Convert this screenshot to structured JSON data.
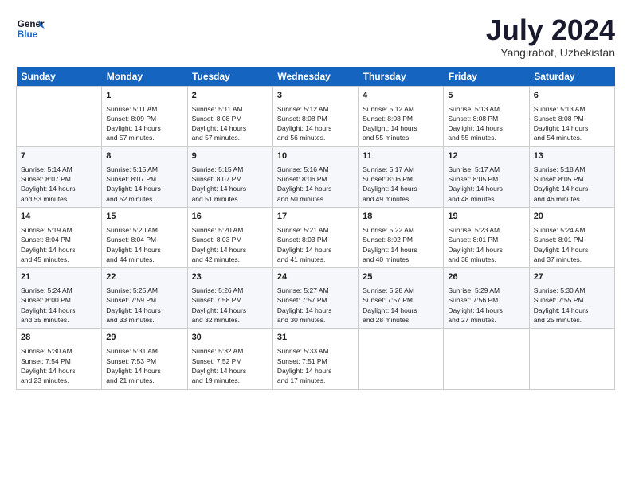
{
  "logo": {
    "line1": "General",
    "line2": "Blue"
  },
  "title": "July 2024",
  "subtitle": "Yangirabot, Uzbekistan",
  "days_header": [
    "Sunday",
    "Monday",
    "Tuesday",
    "Wednesday",
    "Thursday",
    "Friday",
    "Saturday"
  ],
  "weeks": [
    [
      {
        "num": "",
        "data": ""
      },
      {
        "num": "1",
        "data": "Sunrise: 5:11 AM\nSunset: 8:09 PM\nDaylight: 14 hours\nand 57 minutes."
      },
      {
        "num": "2",
        "data": "Sunrise: 5:11 AM\nSunset: 8:08 PM\nDaylight: 14 hours\nand 57 minutes."
      },
      {
        "num": "3",
        "data": "Sunrise: 5:12 AM\nSunset: 8:08 PM\nDaylight: 14 hours\nand 56 minutes."
      },
      {
        "num": "4",
        "data": "Sunrise: 5:12 AM\nSunset: 8:08 PM\nDaylight: 14 hours\nand 55 minutes."
      },
      {
        "num": "5",
        "data": "Sunrise: 5:13 AM\nSunset: 8:08 PM\nDaylight: 14 hours\nand 55 minutes."
      },
      {
        "num": "6",
        "data": "Sunrise: 5:13 AM\nSunset: 8:08 PM\nDaylight: 14 hours\nand 54 minutes."
      }
    ],
    [
      {
        "num": "7",
        "data": "Sunrise: 5:14 AM\nSunset: 8:07 PM\nDaylight: 14 hours\nand 53 minutes."
      },
      {
        "num": "8",
        "data": "Sunrise: 5:15 AM\nSunset: 8:07 PM\nDaylight: 14 hours\nand 52 minutes."
      },
      {
        "num": "9",
        "data": "Sunrise: 5:15 AM\nSunset: 8:07 PM\nDaylight: 14 hours\nand 51 minutes."
      },
      {
        "num": "10",
        "data": "Sunrise: 5:16 AM\nSunset: 8:06 PM\nDaylight: 14 hours\nand 50 minutes."
      },
      {
        "num": "11",
        "data": "Sunrise: 5:17 AM\nSunset: 8:06 PM\nDaylight: 14 hours\nand 49 minutes."
      },
      {
        "num": "12",
        "data": "Sunrise: 5:17 AM\nSunset: 8:05 PM\nDaylight: 14 hours\nand 48 minutes."
      },
      {
        "num": "13",
        "data": "Sunrise: 5:18 AM\nSunset: 8:05 PM\nDaylight: 14 hours\nand 46 minutes."
      }
    ],
    [
      {
        "num": "14",
        "data": "Sunrise: 5:19 AM\nSunset: 8:04 PM\nDaylight: 14 hours\nand 45 minutes."
      },
      {
        "num": "15",
        "data": "Sunrise: 5:20 AM\nSunset: 8:04 PM\nDaylight: 14 hours\nand 44 minutes."
      },
      {
        "num": "16",
        "data": "Sunrise: 5:20 AM\nSunset: 8:03 PM\nDaylight: 14 hours\nand 42 minutes."
      },
      {
        "num": "17",
        "data": "Sunrise: 5:21 AM\nSunset: 8:03 PM\nDaylight: 14 hours\nand 41 minutes."
      },
      {
        "num": "18",
        "data": "Sunrise: 5:22 AM\nSunset: 8:02 PM\nDaylight: 14 hours\nand 40 minutes."
      },
      {
        "num": "19",
        "data": "Sunrise: 5:23 AM\nSunset: 8:01 PM\nDaylight: 14 hours\nand 38 minutes."
      },
      {
        "num": "20",
        "data": "Sunrise: 5:24 AM\nSunset: 8:01 PM\nDaylight: 14 hours\nand 37 minutes."
      }
    ],
    [
      {
        "num": "21",
        "data": "Sunrise: 5:24 AM\nSunset: 8:00 PM\nDaylight: 14 hours\nand 35 minutes."
      },
      {
        "num": "22",
        "data": "Sunrise: 5:25 AM\nSunset: 7:59 PM\nDaylight: 14 hours\nand 33 minutes."
      },
      {
        "num": "23",
        "data": "Sunrise: 5:26 AM\nSunset: 7:58 PM\nDaylight: 14 hours\nand 32 minutes."
      },
      {
        "num": "24",
        "data": "Sunrise: 5:27 AM\nSunset: 7:57 PM\nDaylight: 14 hours\nand 30 minutes."
      },
      {
        "num": "25",
        "data": "Sunrise: 5:28 AM\nSunset: 7:57 PM\nDaylight: 14 hours\nand 28 minutes."
      },
      {
        "num": "26",
        "data": "Sunrise: 5:29 AM\nSunset: 7:56 PM\nDaylight: 14 hours\nand 27 minutes."
      },
      {
        "num": "27",
        "data": "Sunrise: 5:30 AM\nSunset: 7:55 PM\nDaylight: 14 hours\nand 25 minutes."
      }
    ],
    [
      {
        "num": "28",
        "data": "Sunrise: 5:30 AM\nSunset: 7:54 PM\nDaylight: 14 hours\nand 23 minutes."
      },
      {
        "num": "29",
        "data": "Sunrise: 5:31 AM\nSunset: 7:53 PM\nDaylight: 14 hours\nand 21 minutes."
      },
      {
        "num": "30",
        "data": "Sunrise: 5:32 AM\nSunset: 7:52 PM\nDaylight: 14 hours\nand 19 minutes."
      },
      {
        "num": "31",
        "data": "Sunrise: 5:33 AM\nSunset: 7:51 PM\nDaylight: 14 hours\nand 17 minutes."
      },
      {
        "num": "",
        "data": ""
      },
      {
        "num": "",
        "data": ""
      },
      {
        "num": "",
        "data": ""
      }
    ]
  ]
}
